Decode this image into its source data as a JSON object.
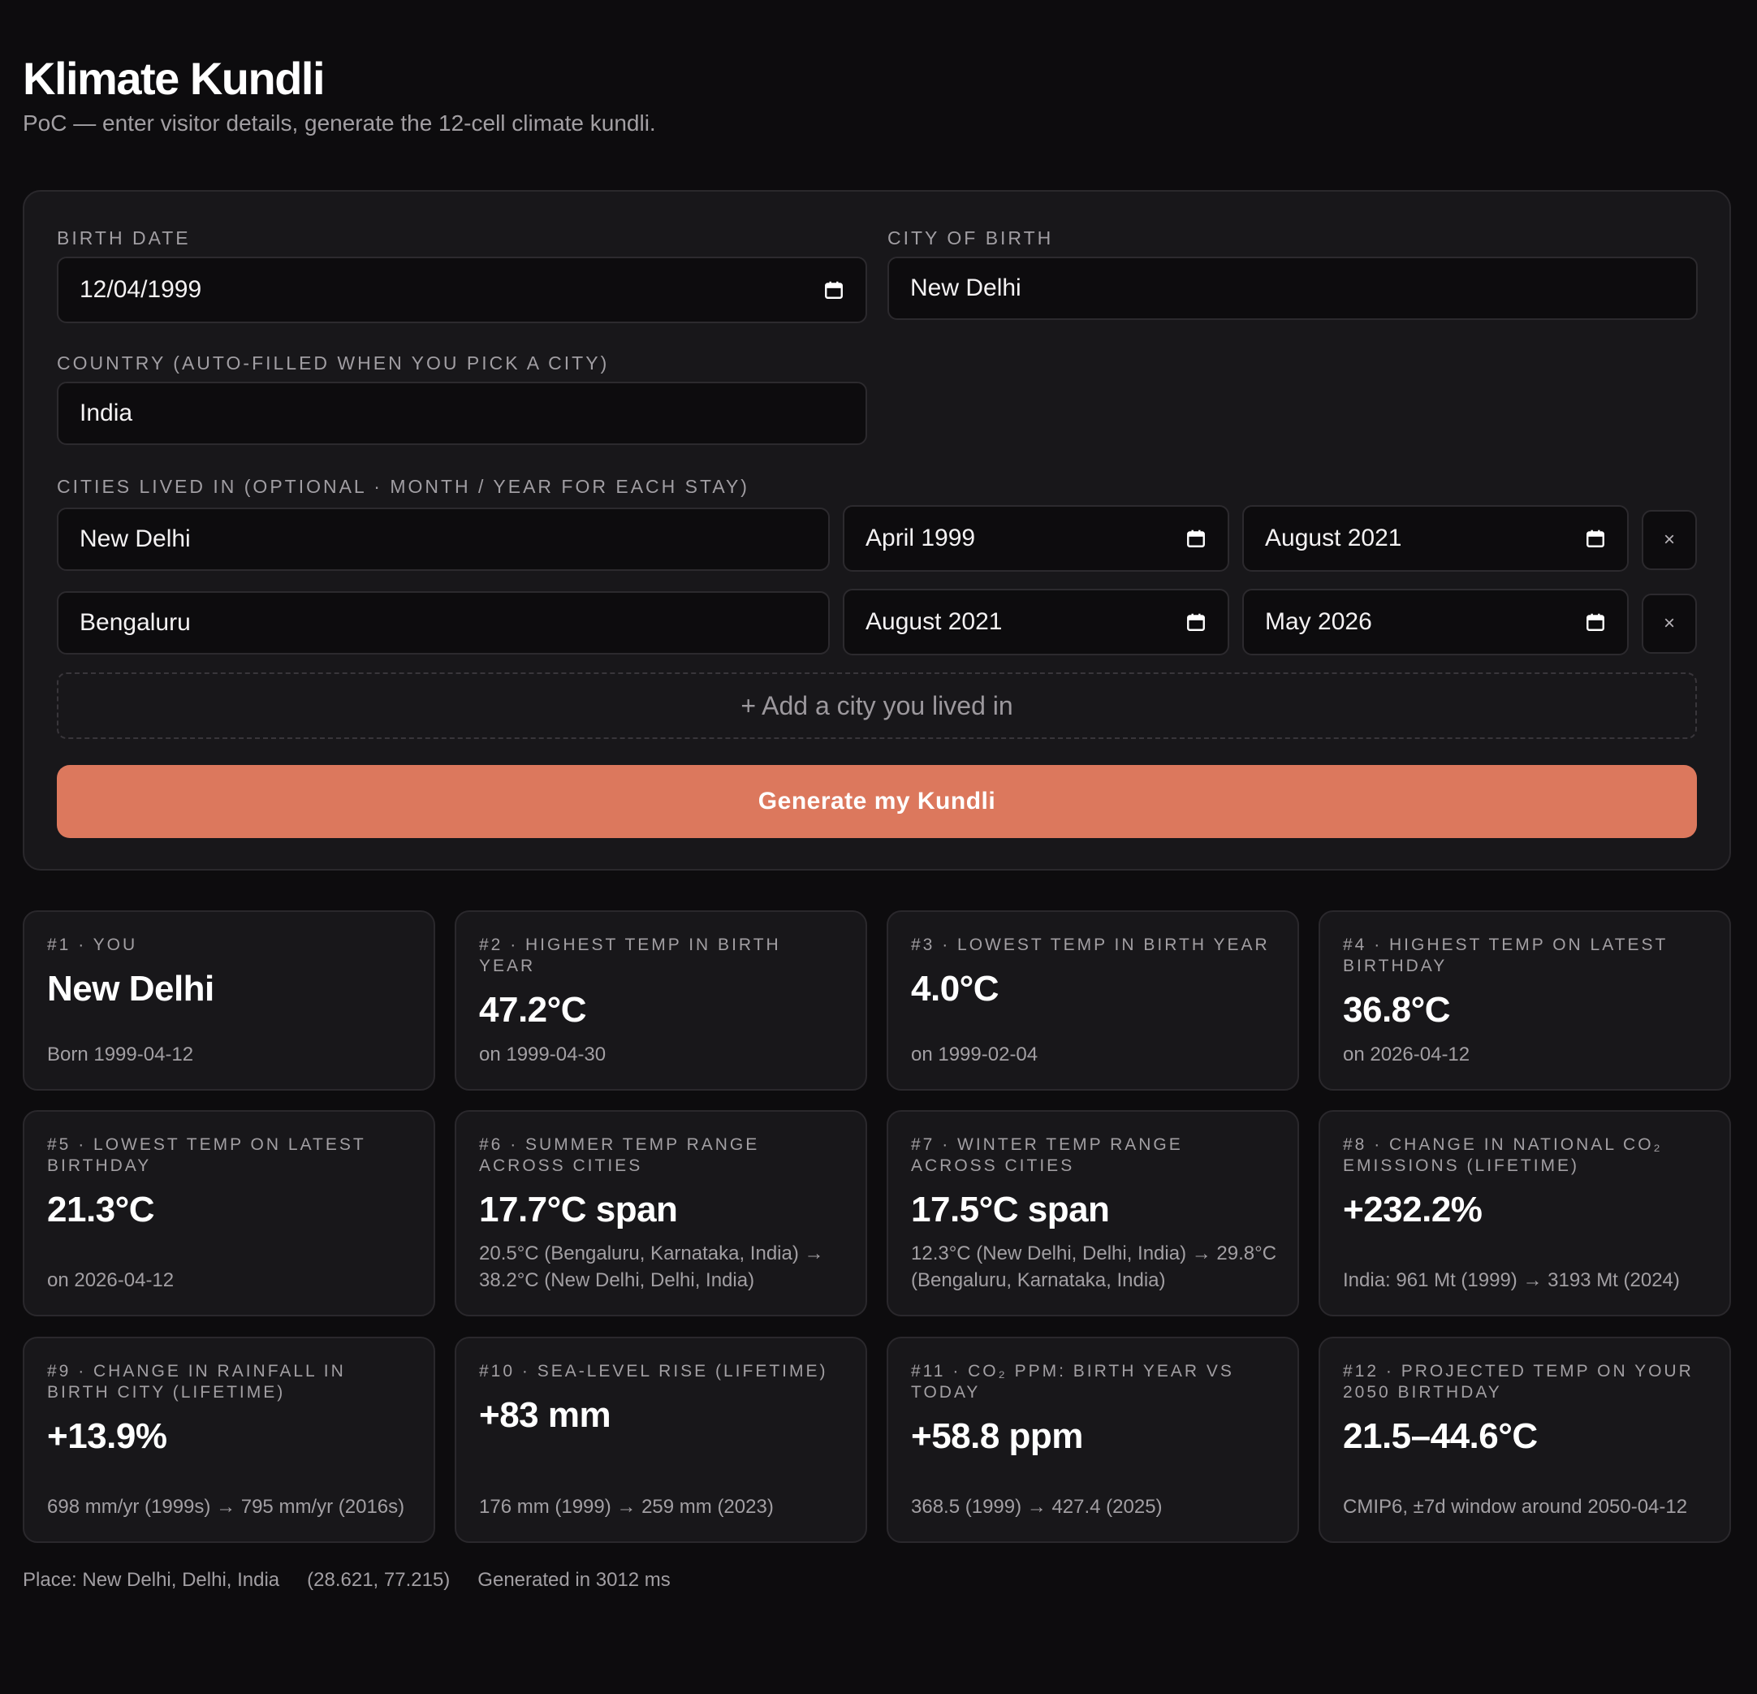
{
  "header": {
    "title": "Klimate Kundli",
    "subtitle": "PoC — enter visitor details, generate the 12-cell climate kundli."
  },
  "form": {
    "birth_date_label": "BIRTH DATE",
    "birth_date_value": "12/04/1999",
    "city_label": "CITY OF BIRTH",
    "city_value": "New Delhi",
    "country_label": "COUNTRY (AUTO-FILLED WHEN YOU PICK A CITY)",
    "country_value": "India",
    "cities_label": "CITIES LIVED IN (OPTIONAL · MONTH / YEAR FOR EACH STAY)",
    "stays": [
      {
        "city": "New Delhi",
        "from": "April 1999",
        "to": "August 2021",
        "remove": "×"
      },
      {
        "city": "Bengaluru",
        "from": "August 2021",
        "to": "May 2026",
        "remove": "×"
      }
    ],
    "add_city_label": "+ Add a city you lived in",
    "generate_label": "Generate my Kundli"
  },
  "cells": [
    {
      "title": "#1 · YOU",
      "value": "New Delhi",
      "note": "Born 1999-04-12"
    },
    {
      "title": "#2 · HIGHEST TEMP IN BIRTH YEAR",
      "value": "47.2°C",
      "note": "on 1999-04-30"
    },
    {
      "title": "#3 · LOWEST TEMP IN BIRTH YEAR",
      "value": "4.0°C",
      "note": "on 1999-02-04"
    },
    {
      "title": "#4 · HIGHEST TEMP ON LATEST BIRTHDAY",
      "value": "36.8°C",
      "note": "on 2026-04-12"
    },
    {
      "title": "#5 · LOWEST TEMP ON LATEST BIRTHDAY",
      "value": "21.3°C",
      "note": "on 2026-04-12"
    },
    {
      "title": "#6 · SUMMER TEMP RANGE ACROSS CITIES",
      "value": "17.7°C span",
      "note": "20.5°C (Bengaluru, Karnataka, India) → 38.2°C (New Delhi, Delhi, India)"
    },
    {
      "title": "#7 · WINTER TEMP RANGE ACROSS CITIES",
      "value": "17.5°C span",
      "note": "12.3°C (New Delhi, Delhi, India) → 29.8°C (Bengaluru, Karnataka, India)"
    },
    {
      "title": "#8 · CHANGE IN NATIONAL CO₂ EMISSIONS (LIFETIME)",
      "value": "+232.2%",
      "note": "India: 961 Mt (1999) → 3193 Mt (2024)"
    },
    {
      "title": "#9 · CHANGE IN RAINFALL IN BIRTH CITY (LIFETIME)",
      "value": "+13.9%",
      "note": "698 mm/yr (1999s) → 795 mm/yr (2016s)"
    },
    {
      "title": "#10 · SEA-LEVEL RISE (LIFETIME)",
      "value": "+83 mm",
      "note": "176 mm (1999) → 259 mm (2023)"
    },
    {
      "title": "#11 · CO₂ PPM: BIRTH YEAR VS TODAY",
      "value": "+58.8 ppm",
      "note": "368.5 (1999) → 427.4 (2025)"
    },
    {
      "title": "#12 · PROJECTED TEMP ON YOUR 2050 BIRTHDAY",
      "value": "21.5–44.6°C",
      "note": "CMIP6, ±7d window around 2050-04-12"
    }
  ],
  "footer": {
    "place": "Place: New Delhi, Delhi, India",
    "coords": "(28.621, 77.215)",
    "generated": "Generated in 3012 ms"
  },
  "colors": {
    "accent": "#dc785d",
    "background": "#0d0c0e",
    "card": "#18171a"
  },
  "icons": {
    "date_picker": "calendar-icon",
    "remove": "close-icon"
  }
}
